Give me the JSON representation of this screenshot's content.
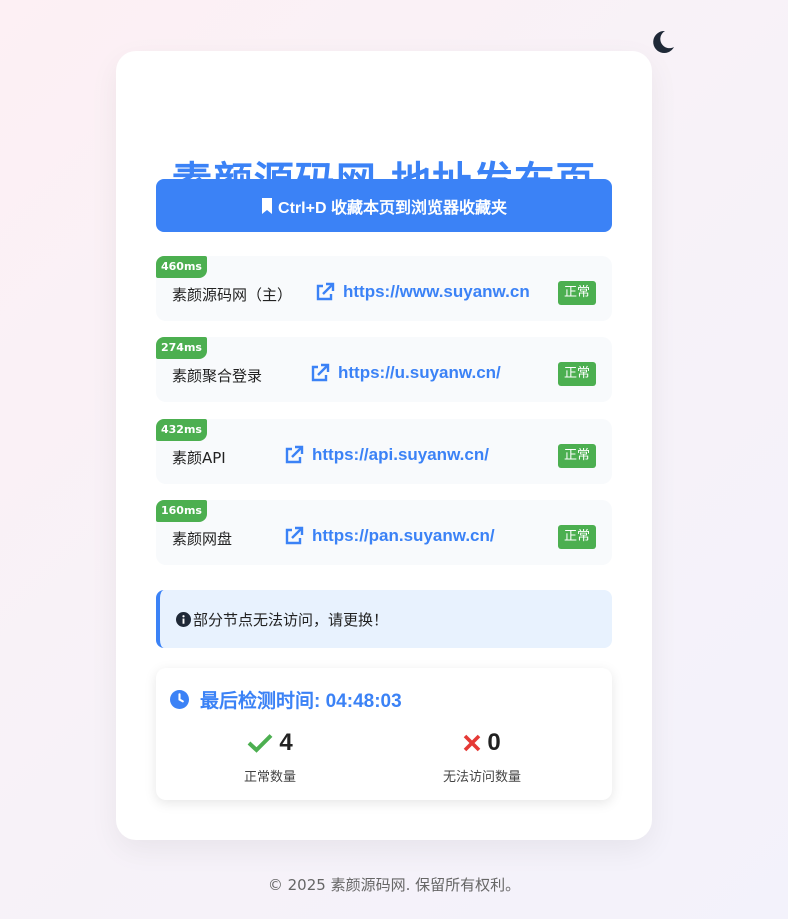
{
  "page_title": "素颜源码网-地址发布页",
  "theme_toggle": {
    "icon": "moon-icon"
  },
  "bookmark_button": {
    "label": "Ctrl+D 收藏本页到浏览器收藏夹",
    "icon": "bookmark-icon"
  },
  "sites": [
    {
      "latency": "460ms",
      "name": "素颜源码网（主）",
      "url": "https://www.suyanw.cn",
      "status": "正常"
    },
    {
      "latency": "274ms",
      "name": "素颜聚合登录",
      "url": "https://u.suyanw.cn/",
      "status": "正常"
    },
    {
      "latency": "432ms",
      "name": "素颜API",
      "url": "https://api.suyanw.cn/",
      "status": "正常"
    },
    {
      "latency": "160ms",
      "name": "素颜网盘",
      "url": "https://pan.suyanw.cn/",
      "status": "正常"
    }
  ],
  "notice": {
    "icon": "info-icon",
    "text": "部分节点无法访问，请更换！"
  },
  "check": {
    "icon": "clock-icon",
    "label": "最后检测时间: 04:48:03",
    "ok_count": "4",
    "ok_label": "正常数量",
    "fail_count": "0",
    "fail_label": "无法访问数量"
  },
  "footer": "© 2025 素颜源码网. 保留所有权利。",
  "colors": {
    "accent": "#3b82f6",
    "success": "#4caf50",
    "danger": "#e53935",
    "moon": "#1f2937"
  }
}
